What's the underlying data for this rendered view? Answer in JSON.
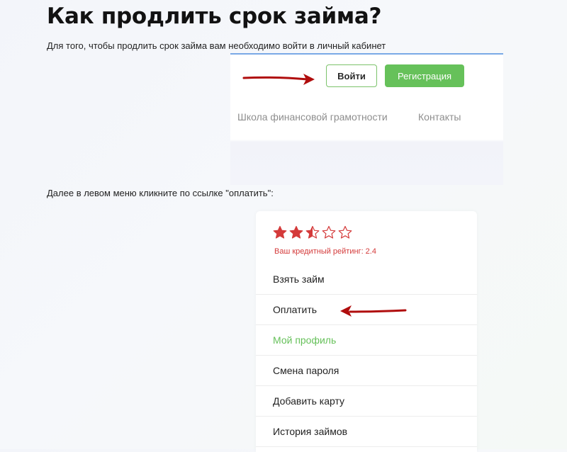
{
  "article": {
    "title": "Как продлить срок займа?",
    "intro": "Для того, чтобы продлить срок займа вам необходимо войти в личный кабинет",
    "step2": "Далее в левом меню кликните по ссылке \"оплатить\":"
  },
  "header_screenshot": {
    "login_label": "Войти",
    "register_label": "Регистрация",
    "nav": {
      "school": "Школа финансовой грамотности",
      "contacts": "Контакты"
    }
  },
  "menu_screenshot": {
    "rating": {
      "value": 2.4,
      "max": 5,
      "label": "Ваш кредитный рейтинг: 2.4"
    },
    "items": [
      {
        "label": "Взять займ",
        "active": false
      },
      {
        "label": "Оплатить",
        "active": false
      },
      {
        "label": "Мой профиль",
        "active": true
      },
      {
        "label": "Смена пароля",
        "active": false
      },
      {
        "label": "Добавить карту",
        "active": false
      },
      {
        "label": "История займов",
        "active": false
      }
    ]
  },
  "colors": {
    "accent_green": "#66c15a",
    "rating_red": "#d43a3a",
    "arrow_red": "#b00d0d",
    "header_border_blue": "#7aa9e6"
  }
}
